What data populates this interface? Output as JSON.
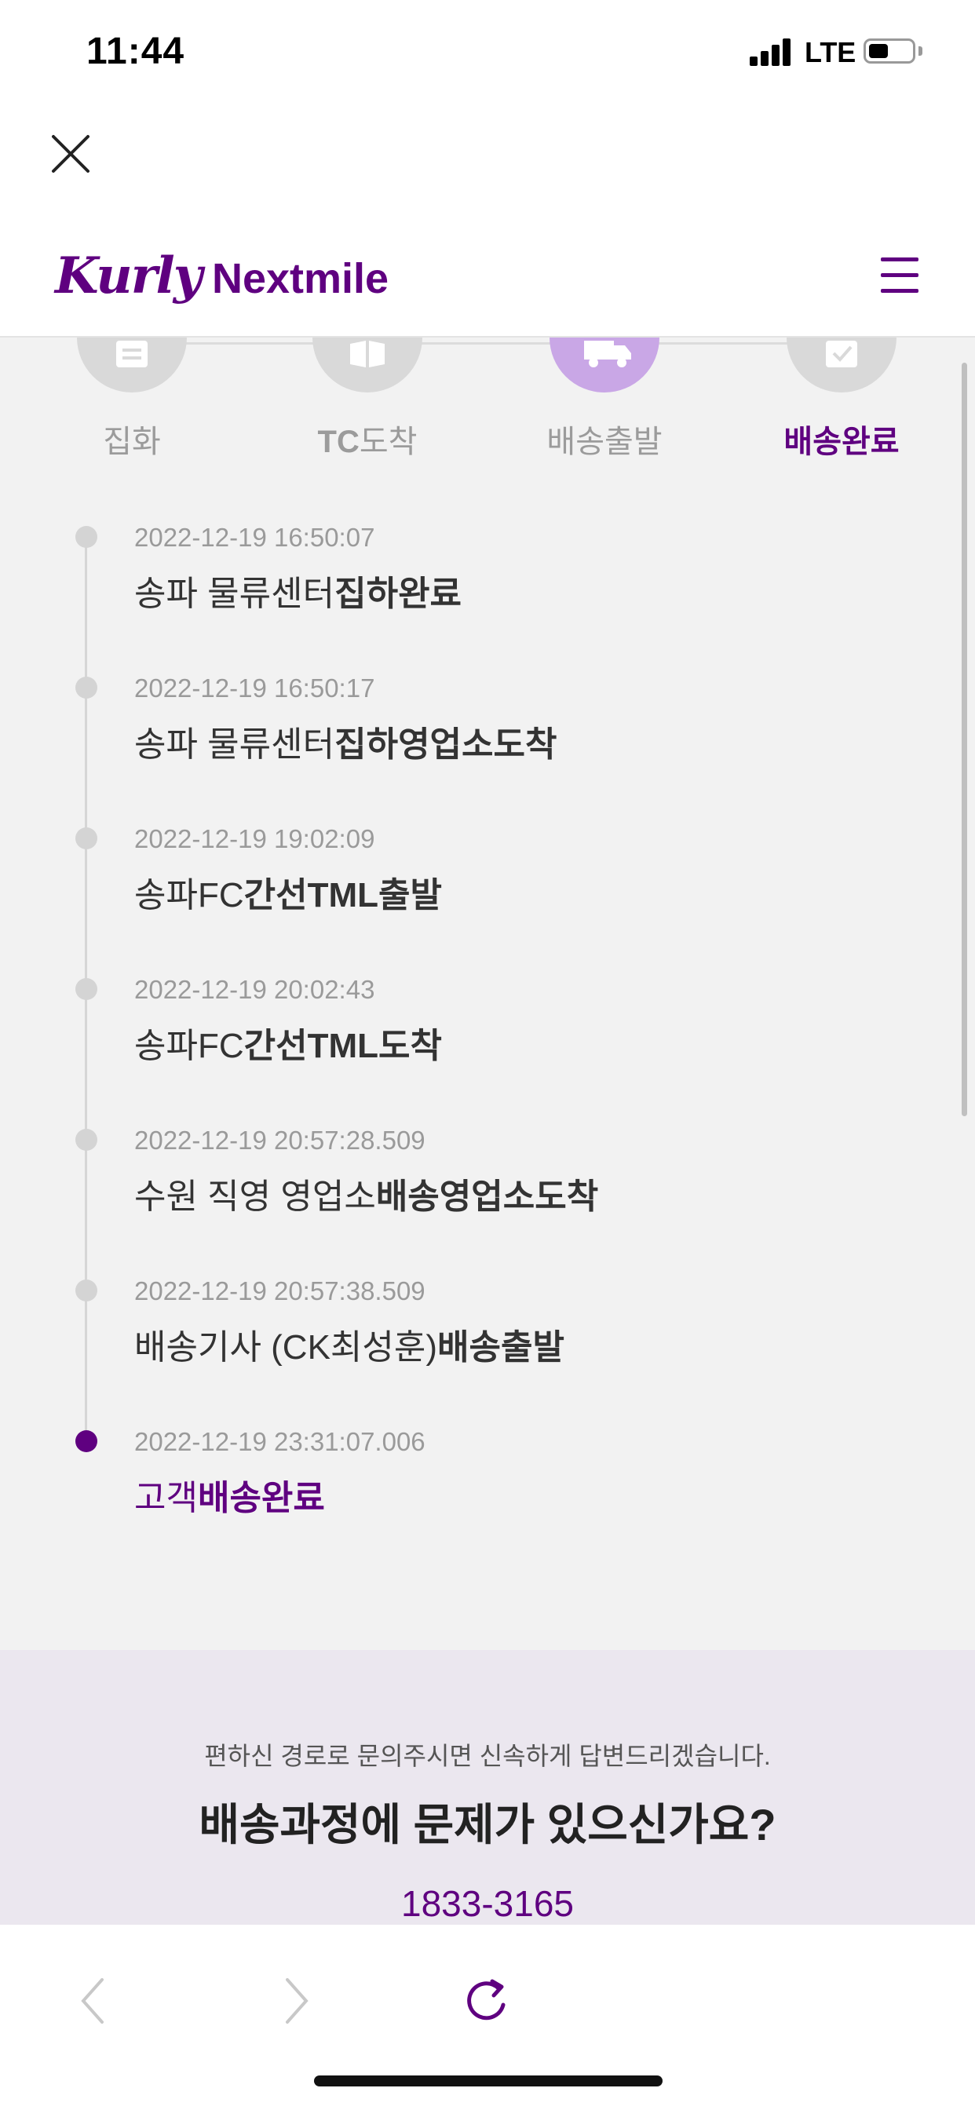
{
  "status_bar": {
    "time": "11:44",
    "network": "LTE"
  },
  "header": {
    "logo_script": "Kurly",
    "logo_text": "Nextmile"
  },
  "steps": [
    {
      "label": "집화",
      "state": "inactive",
      "icon": "document-icon"
    },
    {
      "label": "TC도착",
      "state": "inactive",
      "icon": "box-icon"
    },
    {
      "label": "배송출발",
      "state": "active",
      "icon": "truck-icon"
    },
    {
      "label": "배송완료",
      "state": "done",
      "icon": "check-icon"
    }
  ],
  "timeline": [
    {
      "time": "2022-12-19 16:50:07",
      "place": "송파 물류센터",
      "status": "집하완료"
    },
    {
      "time": "2022-12-19 16:50:17",
      "place": "송파 물류센터",
      "status": "집하영업소도착"
    },
    {
      "time": "2022-12-19 19:02:09",
      "place": "송파FC",
      "status": "간선TML출발"
    },
    {
      "time": "2022-12-19 20:02:43",
      "place": "송파FC",
      "status": "간선TML도착"
    },
    {
      "time": "2022-12-19 20:57:28.509",
      "place": "수원 직영 영업소",
      "status": "배송영업소도착"
    },
    {
      "time": "2022-12-19 20:57:38.509",
      "place": "배송기사 (CK최성훈)",
      "status": "배송출발"
    },
    {
      "time": "2022-12-19 23:31:07.006",
      "place": "고객",
      "status": "배송완료"
    }
  ],
  "help": {
    "subtitle": "편하신 경로로 문의주시면 신속하게 답변드리겠습니다.",
    "title": "배송과정에 문제가 있으신가요?",
    "phone": "1833-3165"
  },
  "colors": {
    "brand": "#5f0080",
    "active_step": "#c9a7e6",
    "inactive": "#d9d9d9"
  }
}
